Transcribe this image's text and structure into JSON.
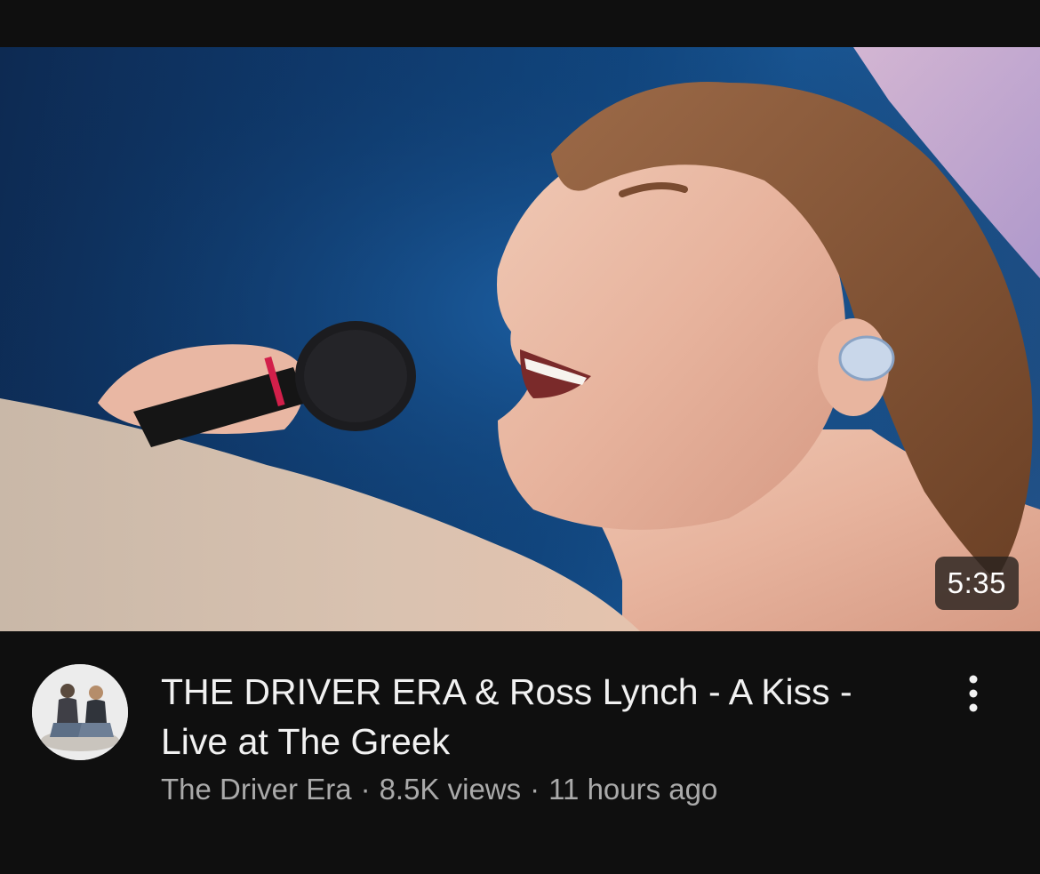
{
  "video": {
    "duration": "5:35",
    "title": "THE DRIVER ERA & Ross Lynch - A Kiss - Live at The Greek",
    "channel": "The Driver Era",
    "views": "8.5K views",
    "age": "11 hours ago",
    "separator": "·"
  },
  "icons": {
    "menu": "more-vert-icon",
    "avatar": "channel-avatar"
  },
  "colors": {
    "background": "#0f0f0f",
    "title_text": "#f1f1f1",
    "secondary_text": "#aaaaaa",
    "badge_bg": "#28221e"
  }
}
